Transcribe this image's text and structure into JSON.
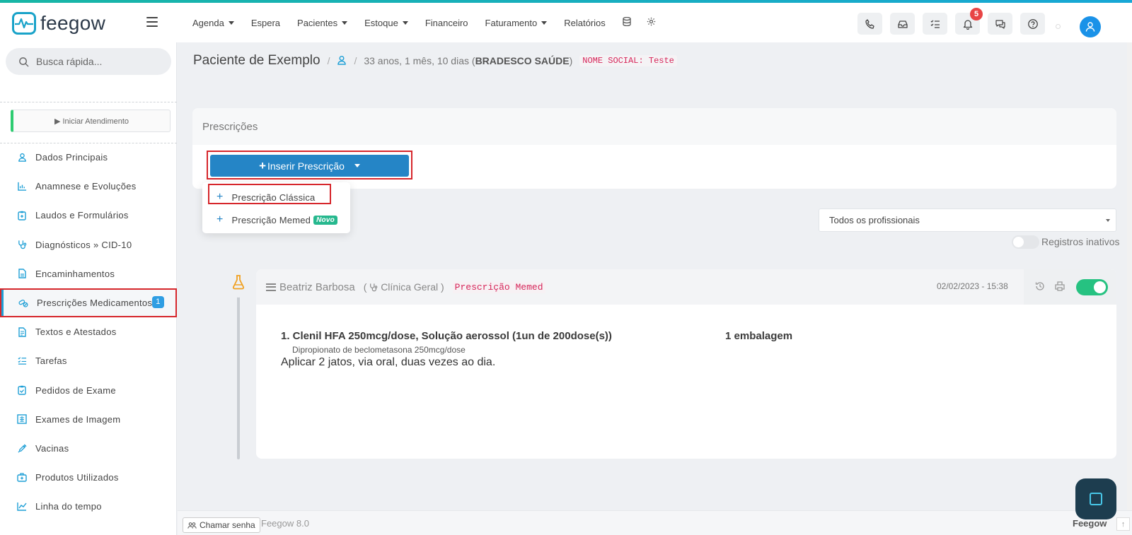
{
  "brand": {
    "name": "feegow",
    "accent": "#1aa3c9"
  },
  "topnav": {
    "items": [
      {
        "label": "Agenda",
        "dropdown": true
      },
      {
        "label": "Espera",
        "dropdown": false
      },
      {
        "label": "Pacientes",
        "dropdown": true
      },
      {
        "label": "Estoque",
        "dropdown": true
      },
      {
        "label": "Financeiro",
        "dropdown": false
      },
      {
        "label": "Faturamento",
        "dropdown": true
      },
      {
        "label": "Relatórios",
        "dropdown": false
      }
    ],
    "notifications_count": "5"
  },
  "sidebar": {
    "search_placeholder": "Busca rápida...",
    "start_label": "▶ Iniciar Atendimento",
    "items": [
      {
        "label": "Dados Principais",
        "icon": "user-icon"
      },
      {
        "label": "Anamnese e Evoluções",
        "icon": "bar-chart-icon"
      },
      {
        "label": "Laudos e Formulários",
        "icon": "clipboard-icon"
      },
      {
        "label": "Diagnósticos » CID-10",
        "icon": "stethoscope-icon"
      },
      {
        "label": "Encaminhamentos",
        "icon": "document-icon"
      },
      {
        "label": "Prescrições Medicamentosas",
        "icon": "pills-icon",
        "badge": "1",
        "active": true
      },
      {
        "label": "Textos e Atestados",
        "icon": "text-file-icon"
      },
      {
        "label": "Tarefas",
        "icon": "task-list-icon"
      },
      {
        "label": "Pedidos de Exame",
        "icon": "clipboard-check-icon"
      },
      {
        "label": "Exames de Imagem",
        "icon": "xray-icon"
      },
      {
        "label": "Vacinas",
        "icon": "syringe-icon"
      },
      {
        "label": "Produtos Utilizados",
        "icon": "kit-icon"
      },
      {
        "label": "Linha do tempo",
        "icon": "line-chart-icon"
      }
    ]
  },
  "breadcrumb": {
    "patient": "Paciente de Exemplo",
    "age": "33 anos, 1 mês, 10 dias",
    "insurance": "BRADESCO SAÚDE",
    "social_name": "NOME SOCIAL: Teste"
  },
  "prescriptions": {
    "panel_title": "Prescrições",
    "insert_label": "Inserir Prescrição",
    "menu": [
      {
        "label": "Prescrição Clássica"
      },
      {
        "label": "Prescrição Memed",
        "badge": "Novo"
      }
    ],
    "filter_value": "Todos os profissionais",
    "inactive_label": "Registros inativos"
  },
  "record": {
    "doctor": "Beatriz Barbosa",
    "specialty": "Clínica Geral",
    "type_tag": "Prescrição Memed",
    "datetime": "02/02/2023 - 15:38",
    "item_name": "1. Clenil HFA 250mcg/dose, Solução aerossol (1un de 200dose(s))",
    "item_qty": "1 embalagem",
    "item_active": "Dipropionato de beclometasona 250mcg/dose",
    "item_instructions": "Aplicar 2 jatos, via oral, duas vezes ao dia."
  },
  "footer": {
    "call_label": "Chamar senha",
    "version": "Feegow 8.0",
    "brand": "Feegow"
  }
}
